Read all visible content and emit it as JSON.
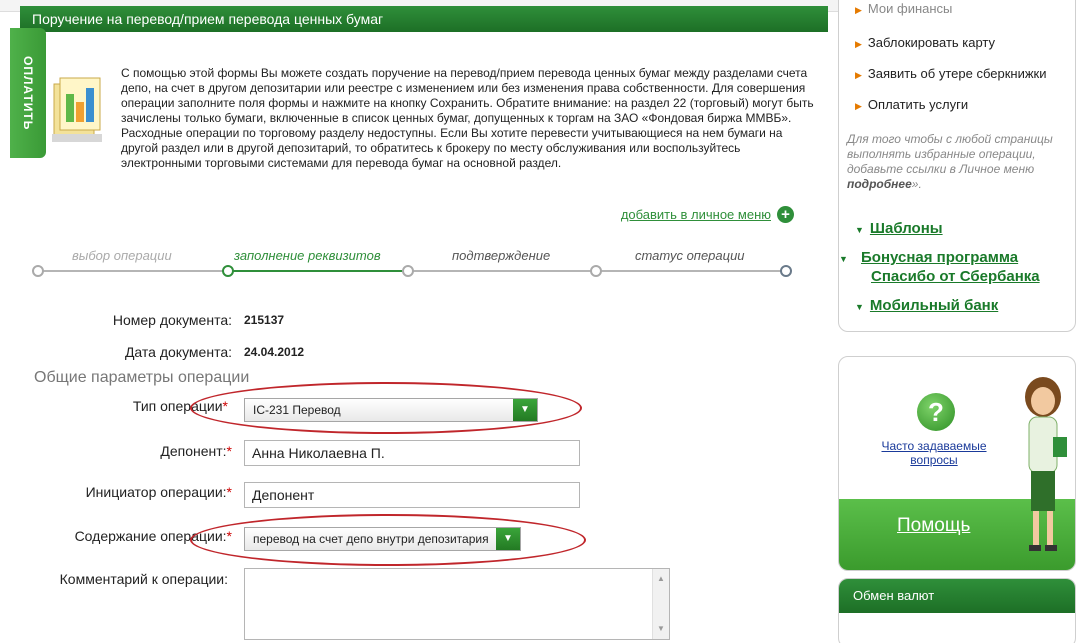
{
  "header": {
    "title": "Поручение на перевод/прием перевода ценных бумаг",
    "pay_tab": "ОПЛАТИТЬ"
  },
  "intro": {
    "text": "С помощью этой формы Вы можете создать поручение на перевод/прием перевода ценных бумаг между разделами счета депо, на счет в другом депозитарии или реестре с изменением или без изменения права собственности. Для совершения операции заполните поля формы и нажмите на кнопку Сохранить. Обратите внимание: на раздел 22 (торговый) могут быть зачислены только бумаги, включенные в список ценных бумаг, допущенных к торгам на ЗАО «Фондовая биржа ММВБ». Расходные операции по торговому разделу недоступны. Если Вы хотите перевести учитывающиеся на нем бумаги на другой раздел или в другой депозитарий, то обратитесь к брокеру по месту обслуживания или воспользуйтесь электронными торговыми системами для перевода бумаг на основной раздел.",
    "add_menu_link": "добавить в личное меню"
  },
  "steps": [
    {
      "label": "выбор операции",
      "state": "done"
    },
    {
      "label": "заполнение реквизитов",
      "state": "active"
    },
    {
      "label": "подтверждение",
      "state": "pending"
    },
    {
      "label": "статус операции",
      "state": "pending"
    }
  ],
  "form": {
    "doc_number_label": "Номер документа:",
    "doc_number": "215137",
    "doc_date_label": "Дата документа:",
    "doc_date": "24.04.2012",
    "section_title": "Общие параметры операции",
    "operation_type_label": "Тип операции",
    "operation_type_value": "IC-231 Перевод",
    "depositor_label": "Депонент:",
    "depositor_value": "Анна Николаевна П.",
    "initiator_label": "Инициатор операции:",
    "initiator_value": "Депонент",
    "content_label": "Содержание операции:",
    "content_value": "перевод на счет депо внутри депозитария",
    "comment_label": "Комментарий к операции:",
    "comment_value": "",
    "required_mark": "*"
  },
  "sidebar": {
    "menu_items": [
      "Мои финансы",
      "Заблокировать карту",
      "Заявить об утере сберкнижки",
      "Оплатить услуги"
    ],
    "hint_before": "Для того чтобы с любой страницы выполнять избранные операции, добавьте ссылки в Личное меню ",
    "hint_link": "подробнее",
    "hint_after": "».",
    "hint_prefix": "»",
    "links": [
      "Шаблоны",
      "Бонусная программа Спасибо от Сбербанка",
      "Мобильный банк"
    ],
    "faq_link": "Часто задаваемые вопросы",
    "help_label": "Помощь",
    "currency_title": "Обмен валют"
  },
  "colors": {
    "brand_green": "#2f8f3a",
    "required_red": "#cc0000",
    "annotation_red": "#c0262b"
  }
}
